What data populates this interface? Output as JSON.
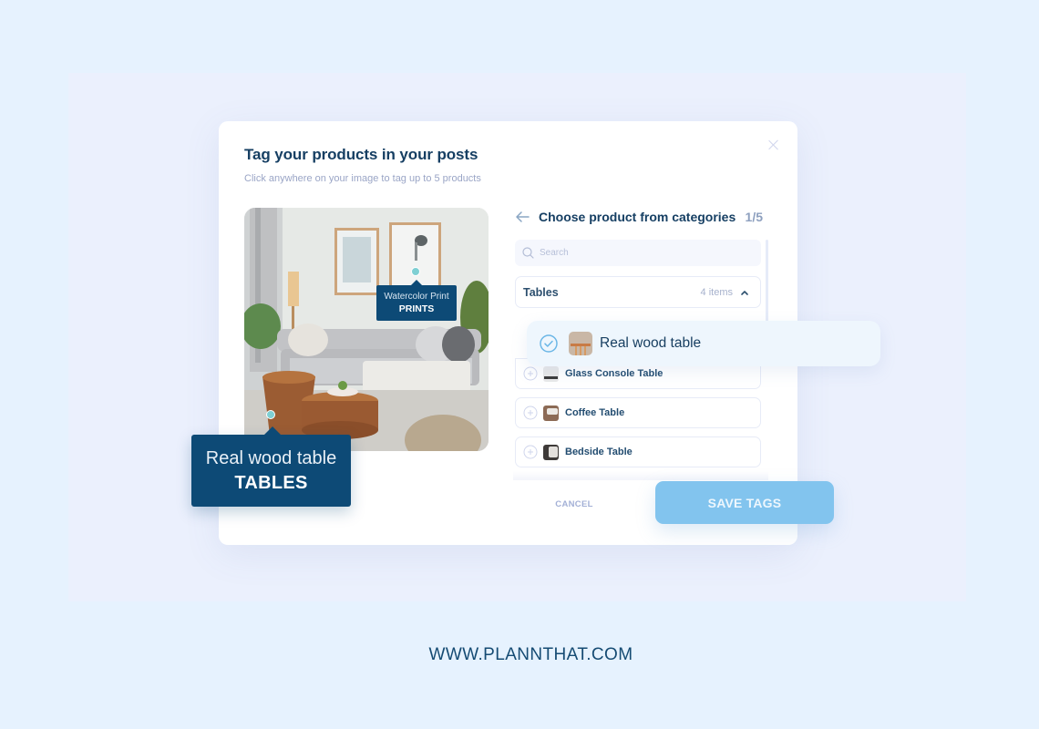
{
  "modal": {
    "title": "Tag your products in your posts",
    "subtitle": "Click anywhere on your image to tag up to 5 products",
    "close_icon": "close-icon"
  },
  "photo": {
    "description": "living room with sofa, wooden side tables, framed prints, plants",
    "tags": [
      {
        "name": "Watercolor Print",
        "category": "PRINTS"
      },
      {
        "name": "Real wood table",
        "category": "TABLES"
      }
    ]
  },
  "panel": {
    "back_icon": "arrow-left-icon",
    "title": "Choose product from categories",
    "count": "1/5",
    "search": {
      "placeholder": "Search",
      "value": ""
    },
    "category": {
      "name": "Tables",
      "count": "4 items",
      "expanded": true
    },
    "selected_item": {
      "name": "Real wood table",
      "checked": true
    },
    "items": [
      {
        "name": "Glass Console Table",
        "checked": false
      },
      {
        "name": "Coffee Table",
        "checked": false
      },
      {
        "name": "Bedside Table",
        "checked": false
      }
    ]
  },
  "actions": {
    "cancel_label": "CANCEL",
    "save_label": "SAVE TAGS"
  },
  "colors": {
    "background": "#e6f2fe",
    "brand_navy": "#0d4a76",
    "save_button": "#82c4ee",
    "hotspot": "#7ecfd3"
  },
  "footer": {
    "url": "WWW.PLANNTHAT.COM"
  }
}
